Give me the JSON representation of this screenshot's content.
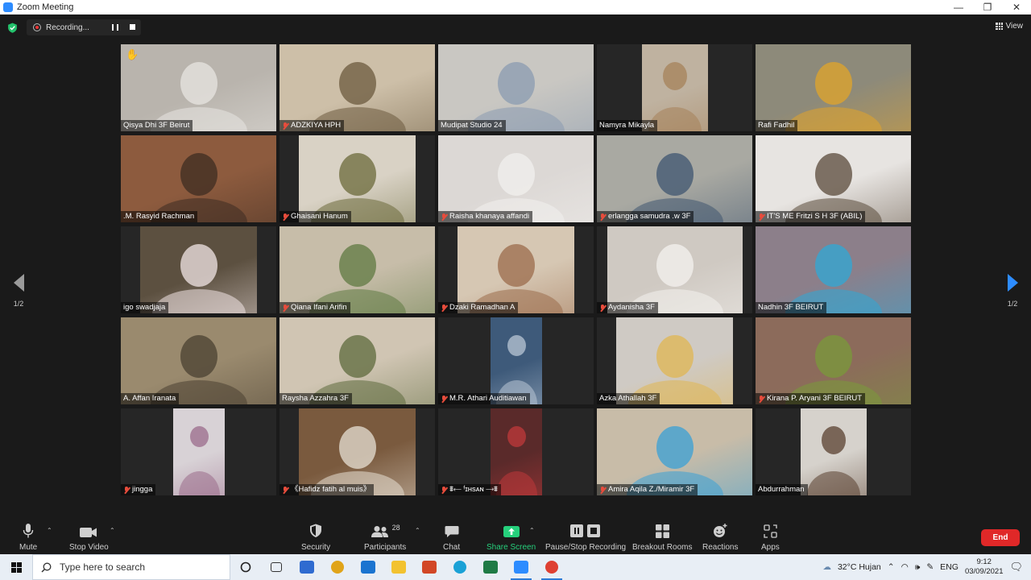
{
  "window": {
    "title": "Zoom Meeting",
    "controls": [
      "—",
      "❐",
      "✕"
    ]
  },
  "recording": {
    "label": "Recording..."
  },
  "view_label": "View",
  "pager": {
    "page": "1/2"
  },
  "participants": [
    {
      "name": "Qisya Dhi 3F Beirut",
      "muted": false,
      "bg": "#b9b4ad",
      "accent": "#e8e6e2",
      "video_w": 193,
      "raised_hand": true
    },
    {
      "name": "ADZKIYA HPH",
      "muted": true,
      "bg": "#cdbfa8",
      "accent": "#6b5a3e",
      "video_w": 193
    },
    {
      "name": "Mudipat Studio 24",
      "muted": false,
      "bg": "#c9c7c2",
      "accent": "#8a9bb0",
      "video_w": 193,
      "active": true
    },
    {
      "name": "Namyra Mikayla",
      "muted": false,
      "bg": "#bfb2a0",
      "accent": "#a5825a",
      "video_w": 82
    },
    {
      "name": "Rafi Fadhil",
      "muted": false,
      "bg": "#8d8a7a",
      "accent": "#e2a42a",
      "video_w": 193
    },
    {
      "name": ".M. Rasyid Rachman",
      "muted": false,
      "bg": "#8d5b3e",
      "accent": "#3d2c22",
      "video_w": 193
    },
    {
      "name": "Ghaisani Hanum",
      "muted": true,
      "bg": "#d9d2c5",
      "accent": "#6b6a3a",
      "video_w": 145
    },
    {
      "name": "Raisha khanaya affandi",
      "muted": true,
      "bg": "#dcd8d5",
      "accent": "#f2f0ee",
      "video_w": 193
    },
    {
      "name": "erlangga samudra .w 3F",
      "muted": true,
      "bg": "#a9a9a2",
      "accent": "#3f5570",
      "video_w": 193
    },
    {
      "name": "IT'S ME Fritzi S H 3F (ABIL)",
      "muted": true,
      "bg": "#e7e4e1",
      "accent": "#5a4a3a",
      "video_w": 193
    },
    {
      "name": "igo swadjaja",
      "muted": false,
      "bg": "#5c5040",
      "accent": "#f2e6e6",
      "video_w": 145
    },
    {
      "name": "Qiana Ifani Arifin",
      "muted": true,
      "bg": "#c7bda9",
      "accent": "#5f7a42",
      "video_w": 193
    },
    {
      "name": "Dzaki Ramadhan A",
      "muted": true,
      "bg": "#d6c7b3",
      "accent": "#9b6b4b",
      "video_w": 145
    },
    {
      "name": "Aydanisha 3F",
      "muted": true,
      "bg": "#cfc9c2",
      "accent": "#f4f2ef",
      "video_w": 168
    },
    {
      "name": "Nadhin 3F BEIRUT",
      "muted": false,
      "bg": "#8c7f8a",
      "accent": "#2fa8d6",
      "video_w": 193
    },
    {
      "name": "A. Affan Iranata",
      "muted": false,
      "bg": "#9a8a6e",
      "accent": "#4a4032",
      "video_w": 193
    },
    {
      "name": "Raysha Azzahra 3F",
      "muted": false,
      "bg": "#d0c5b3",
      "accent": "#5d6a3c",
      "video_w": 193
    },
    {
      "name": "M.R. Athari Auditiawan",
      "muted": true,
      "bg": "#3e5a7a",
      "accent": "#b9c7d6",
      "video_w": 64
    },
    {
      "name": "Azka Athallah 3F",
      "muted": false,
      "bg": "#cfcac4",
      "accent": "#e0b652",
      "video_w": 145
    },
    {
      "name": "Kirana P. Aryani 3F BEIRUT",
      "muted": true,
      "bg": "#8c6b5b",
      "accent": "#7a9a3a",
      "video_w": 193
    },
    {
      "name": "jingga",
      "muted": true,
      "bg": "#d8d2d6",
      "accent": "#9b6b8b",
      "video_w": 64
    },
    {
      "name": "《Hafidz fatih al muis》",
      "muted": true,
      "bg": "#7a5a3e",
      "accent": "#e7e0d4",
      "video_w": 145,
      "emoji_decor": true
    },
    {
      "name": "⩩⟵ ᶠɪʜsᴀɴ ⟶⩩",
      "muted": true,
      "bg": "#5a2a2a",
      "accent": "#c0393b",
      "video_w": 64
    },
    {
      "name": "Amira Aqila Z./Miramir 3F",
      "muted": true,
      "bg": "#c8bca8",
      "accent": "#3aa0d6",
      "video_w": 193
    },
    {
      "name": "Abdurrahman",
      "muted": false,
      "bg": "#d6d2cc",
      "accent": "#5a4030",
      "video_w": 82
    }
  ],
  "toolbar": {
    "mute": "Mute",
    "stop_video": "Stop Video",
    "security": "Security",
    "participants": "Participants",
    "participants_count": "28",
    "chat": "Chat",
    "share_screen": "Share Screen",
    "pause_stop_recording": "Pause/Stop Recording",
    "breakout_rooms": "Breakout Rooms",
    "reactions": "Reactions",
    "apps": "Apps",
    "end": "End"
  },
  "taskbar": {
    "search_placeholder": "Type here to search",
    "weather": "32°C  Hujan",
    "language": "ENG",
    "time": "9:12",
    "date": "03/09/2021",
    "apps": [
      {
        "name": "task-view-icon",
        "color": "#333333"
      },
      {
        "name": "store-icon",
        "color": "#2f6bd0"
      },
      {
        "name": "chrome-icon",
        "color": "#e0a41a"
      },
      {
        "name": "mail-icon",
        "color": "#1b74d0"
      },
      {
        "name": "file-explorer-icon",
        "color": "#f2c230"
      },
      {
        "name": "powerpoint-icon",
        "color": "#d24726"
      },
      {
        "name": "edge-icon",
        "color": "#1aa1d6"
      },
      {
        "name": "excel-icon",
        "color": "#1f7a45"
      },
      {
        "name": "zoom-icon",
        "color": "#2d8cff"
      },
      {
        "name": "chrome-icon-2",
        "color": "#de4032"
      }
    ]
  }
}
